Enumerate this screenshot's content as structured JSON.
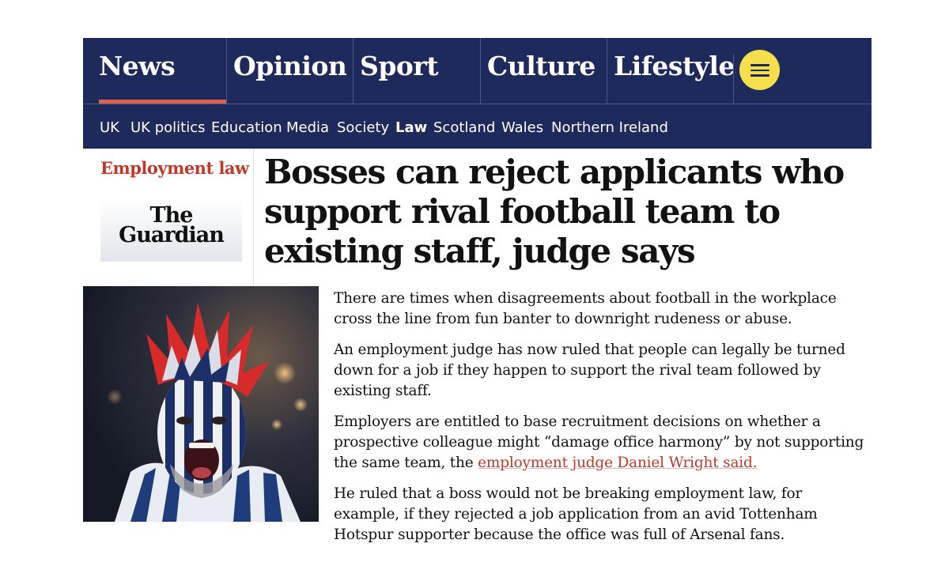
{
  "nav": {
    "pillars": [
      "News",
      "Opinion",
      "Sport",
      "Culture",
      "Lifestyle"
    ],
    "active_pillar": "News",
    "menu_icon": "hamburger-menu-icon",
    "subnav": [
      "UK",
      "UK politics",
      "Education",
      "Media",
      "Society",
      "Law",
      "Scotland",
      "Wales",
      "Northern Ireland"
    ],
    "active_subnav": "Law"
  },
  "article": {
    "kicker": "Employment law",
    "logo_line1": "The",
    "logo_line2": "Guardian",
    "headline": "Bosses can reject applicants who support rival football team to existing staff, judge says",
    "paragraphs": [
      "There are times when disagreements about football in the workplace cross the line from fun banter to downright rudeness or abuse.",
      "An employment judge has now ruled that people can legally be turned down for a job if they happen to support the rival team followed by existing staff."
    ],
    "p3_before": "Employers are entitled to base recruitment decisions on whether a prospective colleague might “damage office harmony” by not supporting the same team, the ",
    "p3_link": "employment judge Daniel Wright said.",
    "p4": "He ruled that a boss would not be breaking employment law, for example, if they rejected a job application from an avid Tottenham Hotspur supporter because the office was full of Arsenal fans."
  },
  "colors": {
    "nav_bg": "#1f2a5c",
    "accent_red": "#c0392b",
    "menu_yellow": "#f5df4d",
    "active_underline": "#e0604e"
  }
}
